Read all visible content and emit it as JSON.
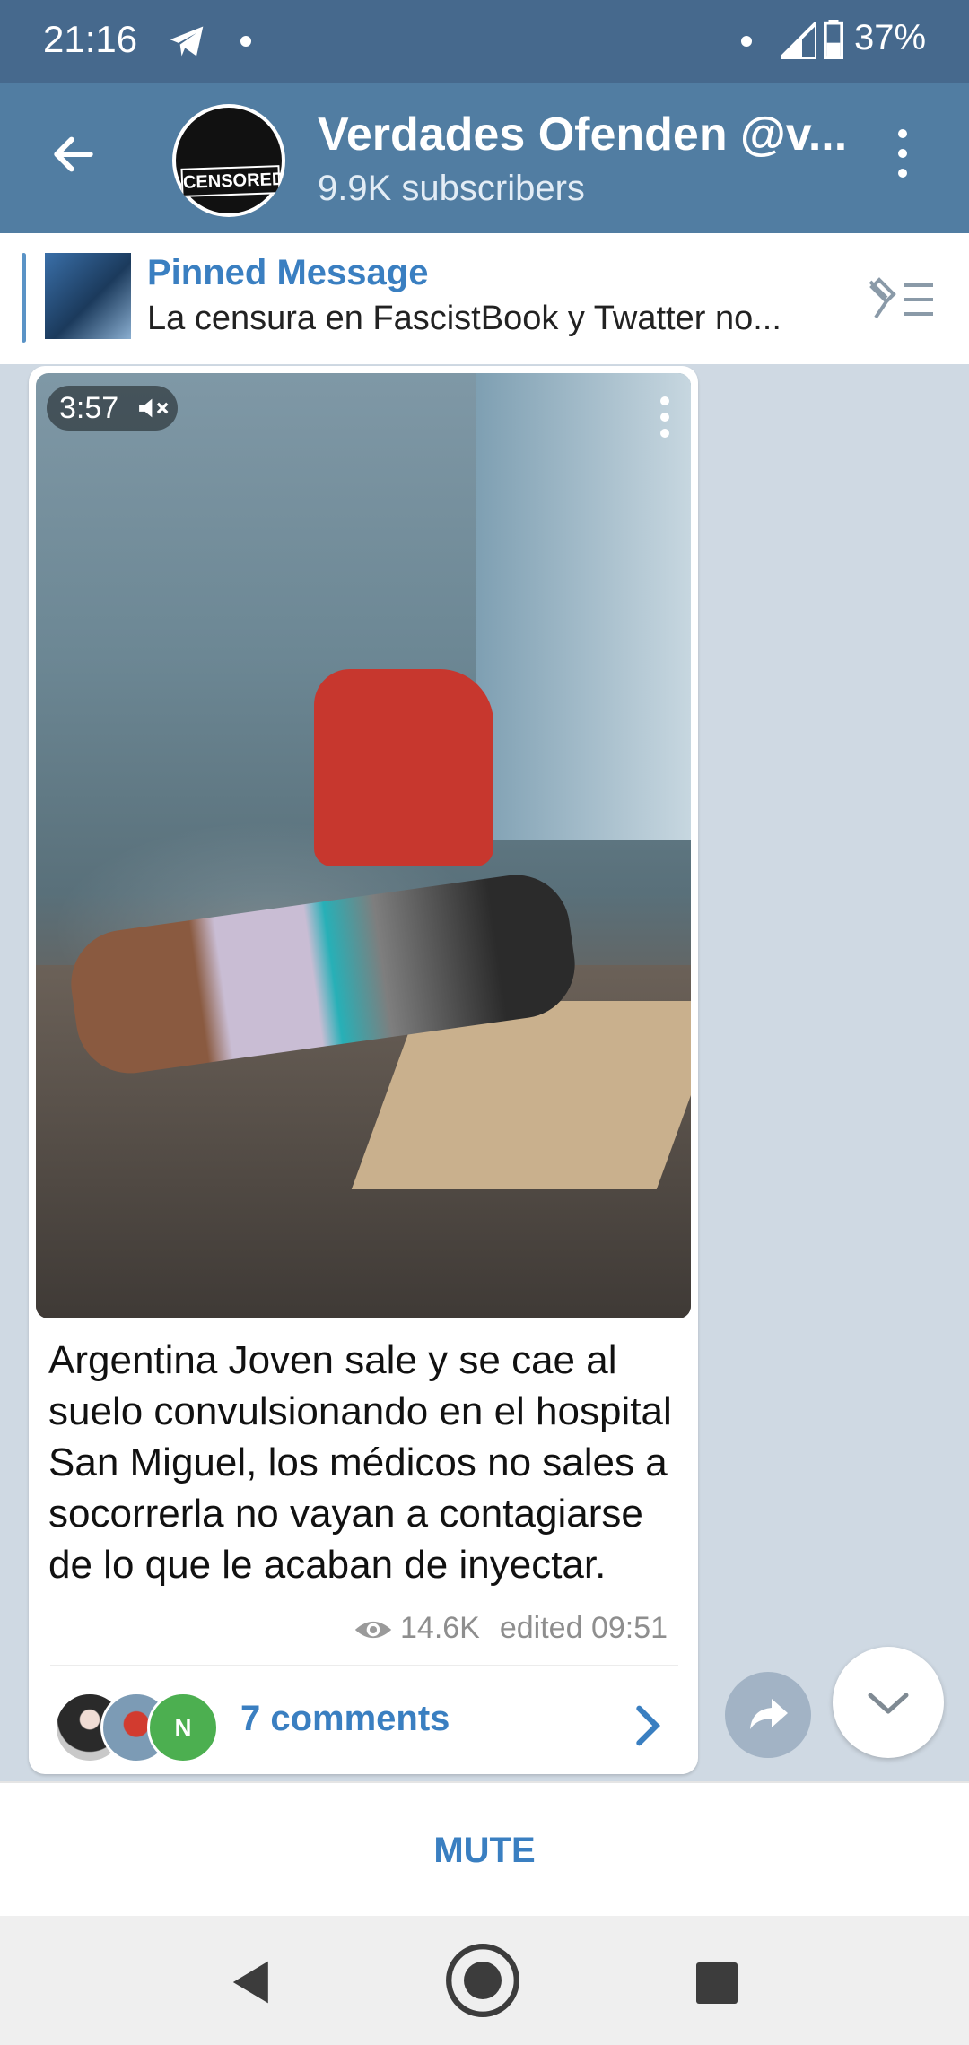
{
  "status_bar": {
    "time": "21:16",
    "battery_percent": "37%",
    "icons": [
      "telegram-icon",
      "dot-icon",
      "signal-icon",
      "battery-icon"
    ]
  },
  "header": {
    "channel_name": "Verdades Ofenden @v...",
    "subscribers": "9.9K subscribers",
    "avatar_text": "CENSORED"
  },
  "pinned": {
    "title": "Pinned Message",
    "text": "La censura en FascistBook y Twatter no..."
  },
  "message": {
    "video_duration": "3:57",
    "caption": "Argentina Joven sale y se cae al suelo convulsionando en el hospital San Miguel, los médicos no sales a socorrerla no vayan a contagiarse de lo que le acaban de inyectar.",
    "views": "14.6K",
    "edited": "edited 09:51",
    "comments_label": "7 comments",
    "comment_avatar_initial": "N"
  },
  "bottom": {
    "mute_label": "MUTE"
  },
  "colors": {
    "header": "#517da2",
    "status_bar": "#46698d",
    "accent": "#3a7fc1"
  }
}
